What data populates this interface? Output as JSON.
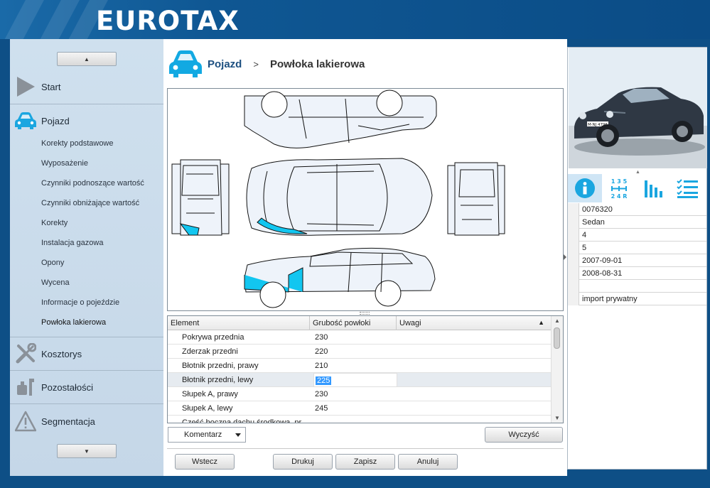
{
  "brand": {
    "logo": "EUROTAX"
  },
  "sidebar": {
    "main_items": [
      {
        "label": "Start",
        "icon": "play-icon"
      },
      {
        "label": "Pojazd",
        "icon": "car-icon"
      },
      {
        "label": "Kosztorys",
        "icon": "tools-icon"
      },
      {
        "label": "Pozostałości",
        "icon": "parts-icon"
      },
      {
        "label": "Segmentacja",
        "icon": "warning-icon"
      }
    ],
    "sub_items": [
      "Korekty podstawowe",
      "Wyposażenie",
      "Czynniki podnoszące wartość",
      "Czynniki obniżające wartość",
      "Korekty",
      "Instalacja gazowa",
      "Opony",
      "Wycena",
      "Informacje o pojeździe",
      "Powłoka lakierowa"
    ],
    "active_sub": "Powłoka lakierowa"
  },
  "breadcrumb": {
    "parent": "Pojazd",
    "separator": ">",
    "current": "Powłoka lakierowa"
  },
  "grid": {
    "columns": [
      "Element",
      "Grubość powłoki",
      "Uwagi"
    ],
    "rows": [
      {
        "element": "Pokrywa przednia",
        "value": "230"
      },
      {
        "element": "Zderzak przedni",
        "value": "220"
      },
      {
        "element": "Błotnik przedni, prawy",
        "value": "210"
      },
      {
        "element": "Błotnik przedni, lewy",
        "value": "225"
      },
      {
        "element": "Słupek A, prawy",
        "value": "230"
      },
      {
        "element": "Słupek A, lewy",
        "value": "245"
      },
      {
        "element": "Część boczna dachu środkowa, pr",
        "value": ""
      }
    ],
    "selected_row": 3
  },
  "controls": {
    "comment_select": "Komentarz",
    "clear_button": "Wyczyść",
    "back_button": "Wstecz",
    "print_button": "Drukuj",
    "save_button": "Zapisz",
    "cancel_button": "Anuluj"
  },
  "vehicle_info": {
    "toolbar_icons": [
      "info-icon",
      "gearbox-icon",
      "bar-chart-icon",
      "checklist-icon"
    ],
    "gear_text_top": "1 3 5",
    "gear_text_bottom": "2 4 R",
    "plate": "M·NJ 4796",
    "values": [
      "0076320",
      "Sedan",
      "4",
      "5",
      "2007-09-01",
      "2008-08-31",
      "",
      "import prywatny"
    ]
  },
  "colors": {
    "header_blue": "#0f5793",
    "accent_cyan": "#00b4e6",
    "damage_cyan": "#12c6f0",
    "sidebar_bg": "#cfe0ee"
  }
}
